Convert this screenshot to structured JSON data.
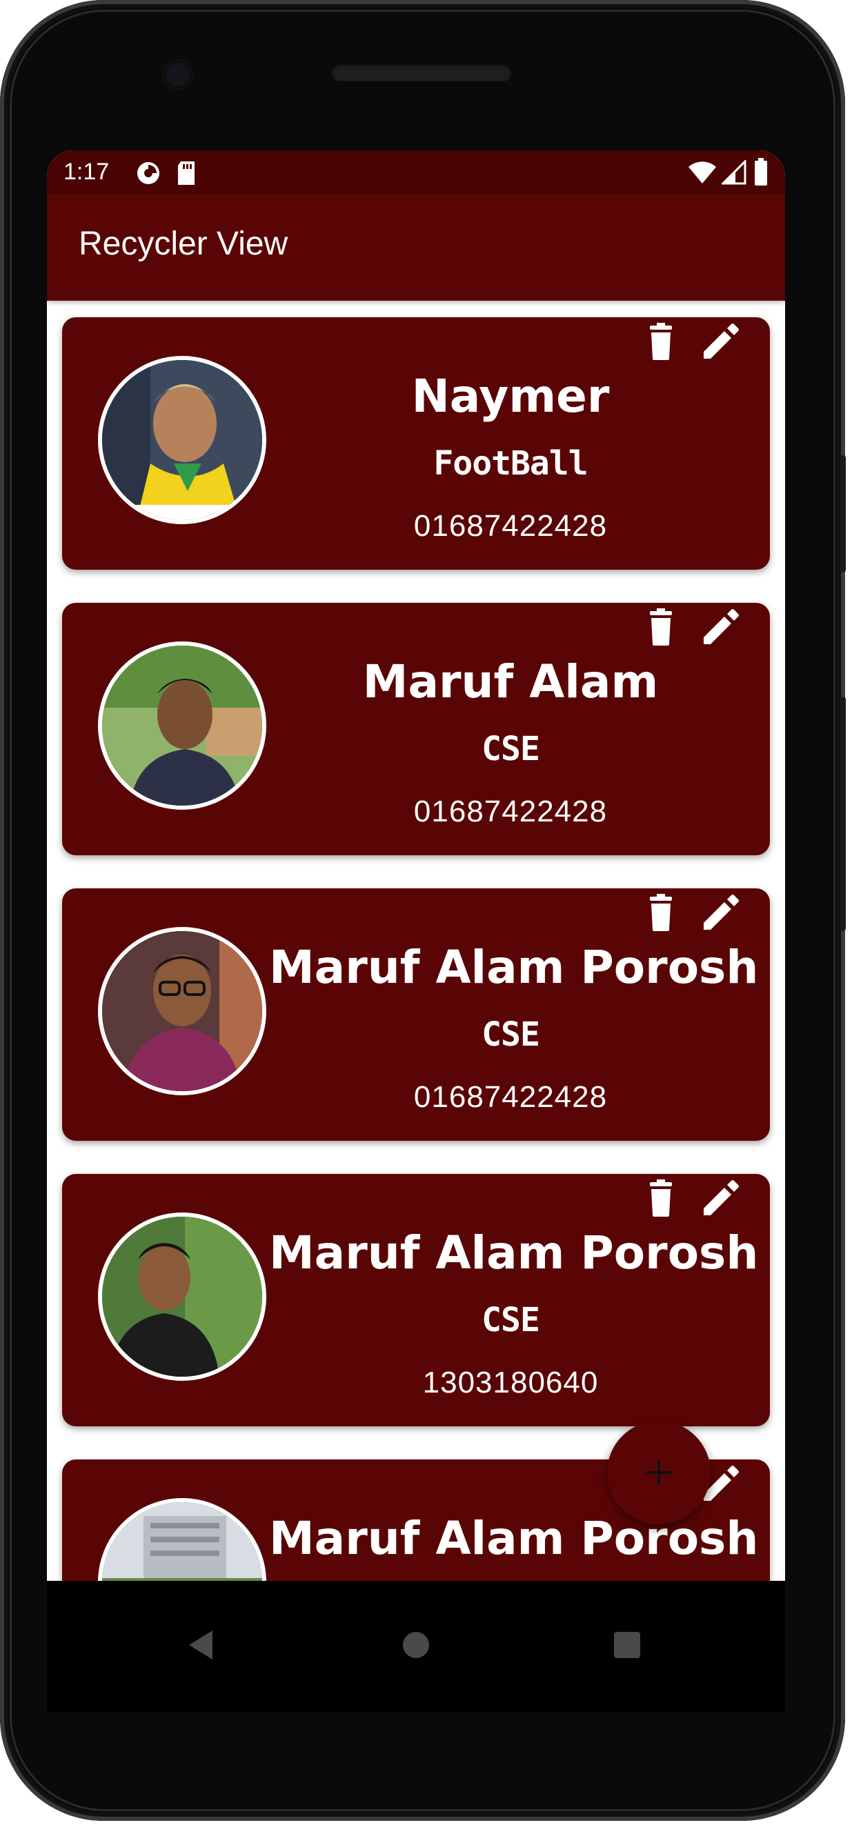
{
  "status_bar": {
    "time": "1:17"
  },
  "app_bar": {
    "title": "Recycler View"
  },
  "cards": [
    {
      "name": "Naymer",
      "subtitle": "FootBall",
      "phone": "01687422428"
    },
    {
      "name": "Maruf Alam",
      "subtitle": "CSE",
      "phone": "01687422428"
    },
    {
      "name": "Maruf Alam Porosh",
      "subtitle": "CSE",
      "phone": "01687422428"
    },
    {
      "name": "Maruf Alam Porosh",
      "subtitle": "CSE",
      "phone": "1303180640"
    },
    {
      "name": "Maruf Alam Porosh",
      "subtitle": "",
      "phone": ""
    }
  ],
  "fab": {
    "label": "+"
  },
  "icons": {
    "delete": "trash-icon",
    "edit": "pencil-icon",
    "add": "plus-icon",
    "back": "back-triangle-icon",
    "home": "home-circle-icon",
    "recents": "recents-square-icon"
  },
  "colors": {
    "accent": "#5a0505",
    "status_bar": "#4a0303",
    "card_text": "#ffffff"
  }
}
